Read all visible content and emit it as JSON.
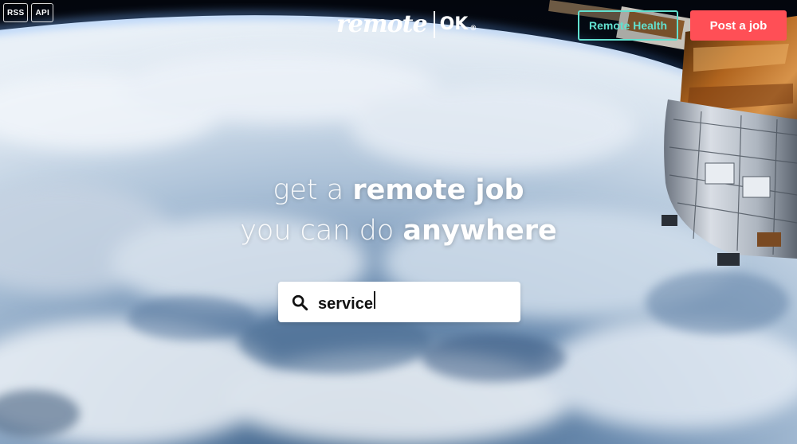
{
  "feeds": [
    {
      "label": "RSS"
    },
    {
      "label": "API"
    }
  ],
  "logo": {
    "wordmark": "remote",
    "suffix": "OK",
    "registered": "®"
  },
  "nav": {
    "health_label": "Remote Health",
    "post_label": "Post a job"
  },
  "hero": {
    "line1_light": "get a ",
    "line1_bold": "remote job",
    "line2_light": "you can do ",
    "line2_bold": "anywhere"
  },
  "search": {
    "value": "service",
    "icon": "search-icon"
  },
  "colors": {
    "accent_teal": "#62e0cf",
    "accent_red": "#ff4f56"
  }
}
